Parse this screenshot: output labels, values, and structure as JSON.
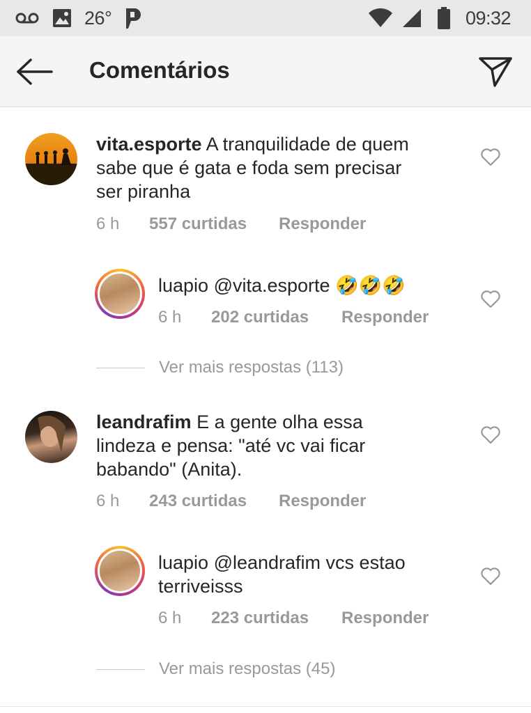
{
  "status_bar": {
    "temperature": "26°",
    "time": "09:32",
    "icons": [
      "voicemail-icon",
      "image-icon",
      "pinterest-icon",
      "wifi-icon",
      "signal-icon",
      "battery-icon"
    ]
  },
  "app_bar": {
    "title": "Comentários",
    "icons": [
      "back-arrow-icon",
      "send-icon"
    ]
  },
  "comments": [
    {
      "user": "vita.esporte",
      "text": "A tranquilidade de quem",
      "line2": "sabe que é gata e foda sem precisar",
      "line3": "ser piranha",
      "time": "6 h",
      "likes": "557 curtidas",
      "reply": "Responder"
    },
    {
      "user": "luapio",
      "text": "@vita.esporte 🤣🤣🤣",
      "time": "6 h",
      "likes": "202 curtidas",
      "reply": "Responder"
    },
    {
      "user": "leandrafim",
      "text": "E a gente olha essa",
      "line2": "lindeza e pensa: \"até vc vai ficar",
      "line3": "babando\" (Anita).",
      "time": "6 h",
      "likes": "243 curtidas",
      "reply": "Responder"
    },
    {
      "user": "luapio",
      "text": "@leandrafim vcs estao",
      "line2": "terriveisss",
      "time": "6 h",
      "likes": "223 curtidas",
      "reply": "Responder"
    }
  ],
  "more_replies": [
    "Ver mais respostas (113)",
    "Ver mais respostas (45)"
  ],
  "colors": {
    "status_bar_bg": "#e8e8e8",
    "app_bar_bg": "#f5f5f5",
    "text": "#262626",
    "meta": "#999999",
    "story_ring": "#c13584"
  }
}
